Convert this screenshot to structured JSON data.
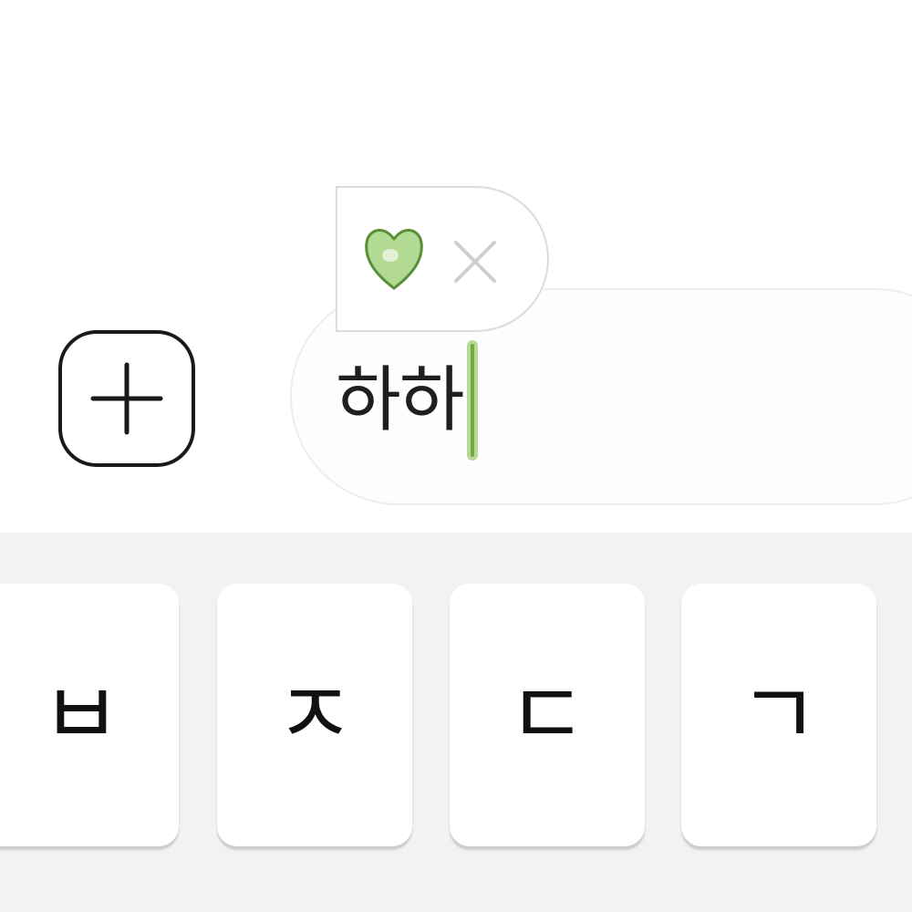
{
  "composer": {
    "add_button_icon": "plus-icon",
    "message_text": "하하",
    "caret_color": "#6fae3d"
  },
  "suggestion": {
    "emoji_icon": "green-heart-icon",
    "emoji_color": "#a8d58a",
    "dismiss_icon": "close-icon"
  },
  "keyboard": {
    "keys": [
      {
        "label": "ㅂ"
      },
      {
        "label": "ㅈ"
      },
      {
        "label": "ㄷ"
      },
      {
        "label": "ㄱ"
      }
    ]
  }
}
